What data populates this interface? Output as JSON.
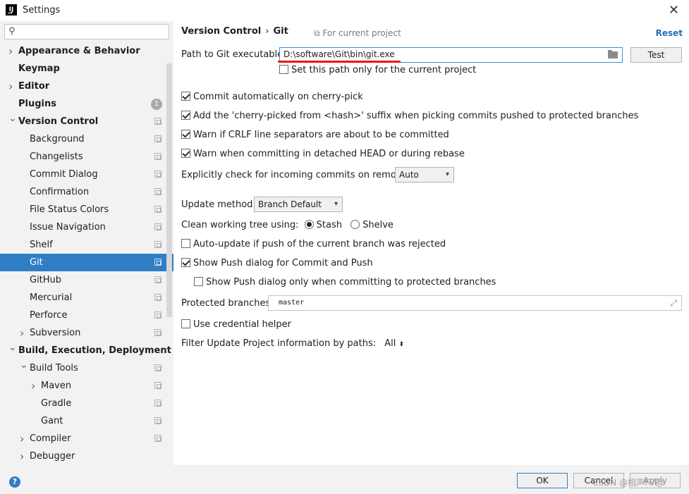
{
  "window": {
    "title": "Settings",
    "app_icon": "IJ"
  },
  "search": {
    "placeholder": ""
  },
  "sidebar": {
    "items": [
      {
        "label": "Appearance & Behavior",
        "level": 0,
        "bold": true,
        "chevron": "right",
        "icon": false
      },
      {
        "label": "Keymap",
        "level": 0,
        "bold": true,
        "chevron": "",
        "icon": false
      },
      {
        "label": "Editor",
        "level": 0,
        "bold": true,
        "chevron": "right",
        "icon": false
      },
      {
        "label": "Plugins",
        "level": 0,
        "bold": true,
        "chevron": "",
        "icon": false,
        "badge": "1"
      },
      {
        "label": "Version Control",
        "level": 0,
        "bold": true,
        "chevron": "down",
        "icon": true
      },
      {
        "label": "Background",
        "level": 1,
        "icon": true
      },
      {
        "label": "Changelists",
        "level": 1,
        "icon": true
      },
      {
        "label": "Commit Dialog",
        "level": 1,
        "icon": true
      },
      {
        "label": "Confirmation",
        "level": 1,
        "icon": true
      },
      {
        "label": "File Status Colors",
        "level": 1,
        "icon": true
      },
      {
        "label": "Issue Navigation",
        "level": 1,
        "icon": true
      },
      {
        "label": "Shelf",
        "level": 1,
        "icon": true
      },
      {
        "label": "Git",
        "level": 1,
        "icon": true,
        "selected": true
      },
      {
        "label": "GitHub",
        "level": 1,
        "icon": true
      },
      {
        "label": "Mercurial",
        "level": 1,
        "icon": true
      },
      {
        "label": "Perforce",
        "level": 1,
        "icon": true
      },
      {
        "label": "Subversion",
        "level": 1,
        "chevron": "right",
        "icon": true
      },
      {
        "label": "Build, Execution, Deployment",
        "level": 0,
        "bold": true,
        "chevron": "down",
        "icon": false
      },
      {
        "label": "Build Tools",
        "level": 1,
        "chevron": "down",
        "icon": true
      },
      {
        "label": "Maven",
        "level": 2,
        "chevron": "right",
        "icon": true
      },
      {
        "label": "Gradle",
        "level": 2,
        "icon": true
      },
      {
        "label": "Gant",
        "level": 2,
        "icon": true
      },
      {
        "label": "Compiler",
        "level": 1,
        "chevron": "right",
        "icon": true
      },
      {
        "label": "Debugger",
        "level": 1,
        "chevron": "right",
        "icon": false
      }
    ]
  },
  "header": {
    "breadcrumb_parent": "Version Control",
    "breadcrumb_sep": "›",
    "breadcrumb_current": "Git",
    "for_project": "For current project",
    "reset": "Reset"
  },
  "git": {
    "path_label": "Path to Git executable:",
    "path_value": "D:\\software\\Git\\bin\\git.exe",
    "test_label": "Test",
    "project_only_label": "Set this path only for the current project",
    "commit_cherry_pick": "Commit automatically on cherry-pick",
    "cherry_suffix": "Add the 'cherry-picked from <hash>' suffix when picking commits pushed to protected branches",
    "warn_crlf": "Warn if CRLF line separators are about to be committed",
    "warn_detached": "Warn when committing in detached HEAD or during rebase",
    "incoming_label": "Explicitly check for incoming commits on remotes:",
    "incoming_value": "Auto",
    "update_method_label": "Update method:",
    "update_method_value": "Branch Default",
    "clean_tree_label": "Clean working tree using:",
    "stash_label": "Stash",
    "shelve_label": "Shelve",
    "auto_update": "Auto-update if push of the current branch was rejected",
    "show_push": "Show Push dialog for Commit and Push",
    "show_push_protected": "Show Push dialog only when committing to protected branches",
    "protected_label": "Protected branches:",
    "protected_value": "master",
    "credential_helper": "Use credential helper",
    "filter_label": "Filter Update Project information by paths:",
    "filter_value": "All"
  },
  "footer": {
    "ok": "OK",
    "cancel": "Cancel",
    "apply": "Apply",
    "watermark": "CSDN @相声FV@"
  },
  "colors": {
    "accent": "#2f7ec4",
    "annotation": "#e11111"
  }
}
